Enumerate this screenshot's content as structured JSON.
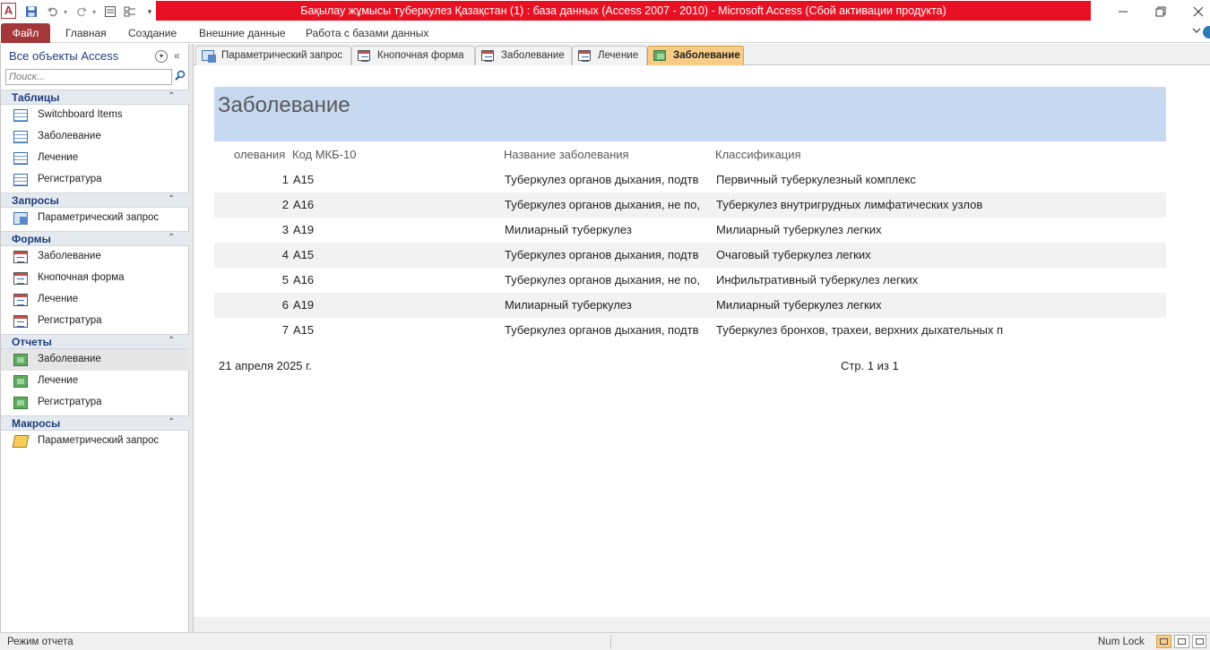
{
  "window": {
    "title": "Бақылау жұмысы туберкулез Қазақстан (1) : база данных (Access 2007 - 2010)  -  Microsoft Access (Сбой активации продукта)",
    "app_icon": "A",
    "title_color": "#e81123",
    "controls": {
      "minimize": "—",
      "restore": "❐",
      "close": "✕"
    }
  },
  "quick_access": {
    "icons": [
      "save-icon",
      "undo-icon",
      "redo-icon",
      "form-icon",
      "design-icon",
      "customize-icon"
    ]
  },
  "ribbon": {
    "tabs": [
      "Файл",
      "Главная",
      "Создание",
      "Внешние данные",
      "Работа с базами данных"
    ],
    "accent": "#a4373a"
  },
  "nav": {
    "title": "Все объекты Access",
    "search_placeholder": "Поиск...",
    "groups": [
      {
        "label": "Таблицы",
        "items": [
          "Switchboard Items",
          "Заболевание",
          "Лечение",
          "Регистратура"
        ]
      },
      {
        "label": "Запросы",
        "items": [
          "Параметрический запрос"
        ]
      },
      {
        "label": "Формы",
        "items": [
          "Заболевание",
          "Кнопочная форма",
          "Лечение",
          "Регистратура"
        ]
      },
      {
        "label": "Отчеты",
        "items": [
          "Заболевание",
          "Лечение",
          "Регистратура"
        ],
        "selected": "Заболевание"
      },
      {
        "label": "Макросы",
        "items": [
          "Параметрический запрос"
        ]
      }
    ]
  },
  "doc_tabs": [
    {
      "label": "Параметрический запрос",
      "icon": "query-icon"
    },
    {
      "label": "Кнопочная форма",
      "icon": "form-icon"
    },
    {
      "label": "Заболевание",
      "icon": "form-icon"
    },
    {
      "label": "Лечение",
      "icon": "form-icon"
    },
    {
      "label": "Заболевание",
      "icon": "report-icon",
      "active": true
    }
  ],
  "report": {
    "title": "Заболевание",
    "header_color": "#c6d9f1",
    "columns": {
      "id": "олевания",
      "code": "Код МКБ-10",
      "name": "Название заболевания",
      "class": "Классификация"
    },
    "rows": [
      {
        "id": "1",
        "code": "A15",
        "name": "Туберкулез органов дыхания, подтв",
        "class": "Первичный туберкулезный комплекс"
      },
      {
        "id": "2",
        "code": "A16",
        "name": "Туберкулез органов дыхания, не по,",
        "class": "Туберкулез внутригрудных лимфатических узлов"
      },
      {
        "id": "3",
        "code": "A19",
        "name": "Милиарный туберкулез",
        "class": "Милиарный туберкулез легких"
      },
      {
        "id": "4",
        "code": "A15",
        "name": "Туберкулез органов дыхания, подтв",
        "class": "Очаговый туберкулез легких"
      },
      {
        "id": "5",
        "code": "A16",
        "name": "Туберкулез органов дыхания, не по,",
        "class": "Инфильтративный туберкулез легких"
      },
      {
        "id": "6",
        "code": "A19",
        "name": "Милиарный туберкулез",
        "class": "Милиарный туберкулез легких"
      },
      {
        "id": "7",
        "code": "A15",
        "name": "Туберкулез органов дыхания, подтв",
        "class": "Туберкулез бронхов, трахеи, верхних дыхательных п"
      }
    ],
    "footer_date": "21 апреля 2025 г.",
    "footer_page": "Стр. 1 из 1"
  },
  "status": {
    "mode": "Режим отчета",
    "numlock": "Num Lock"
  }
}
